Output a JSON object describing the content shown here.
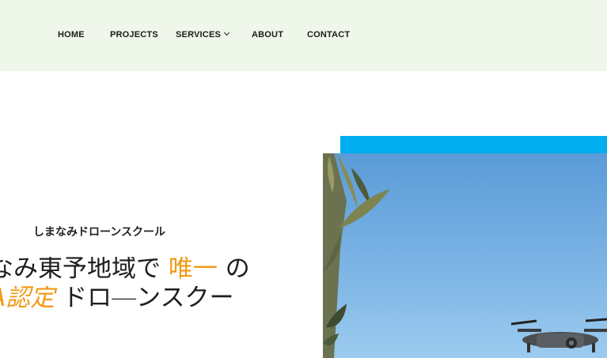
{
  "nav": {
    "items": [
      {
        "label": "HOME"
      },
      {
        "label": "PROJECTS"
      },
      {
        "label": "SERVICES"
      },
      {
        "label": "ABOUT"
      },
      {
        "label": "CONTACT"
      }
    ]
  },
  "hero": {
    "subtitle": "しまなみドローンスクール",
    "line1_pre": "なみ東予地域で ",
    "line1_accent": "唯一",
    "line1_post": " の",
    "line2_accent": "A認定",
    "line2_post": " ドロ―ンスクー",
    "colors": {
      "accent": "#f29a18",
      "band": "#00adef",
      "nav_bg": "#eff6ea"
    },
    "photo_subject": "drone-over-sky-with-olive-branches"
  }
}
